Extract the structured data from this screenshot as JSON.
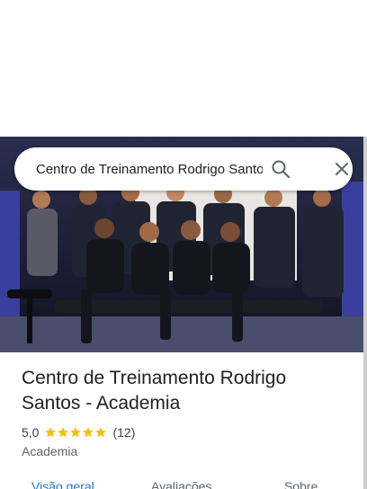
{
  "search": {
    "value": "Centro de Treinamento Rodrigo Santos - Academia",
    "search_icon": "search-icon",
    "close_icon": "close-icon"
  },
  "hero": {
    "description_icon": "place-photo",
    "background_color": "#1b1d33"
  },
  "place": {
    "title": "Centro de Treinamento Rodrigo Santos - Academia",
    "rating": "5,0",
    "star_count": 5,
    "star_color": "#fbbc04",
    "reviews": "(12)",
    "category": "Academia"
  },
  "tabs": [
    {
      "label": "Visão geral",
      "active": true
    },
    {
      "label": "Avaliações",
      "active": false
    },
    {
      "label": "Sobre",
      "active": false
    }
  ],
  "colors": {
    "accent": "#1a73e8",
    "text": "#202124",
    "muted": "#5f6368"
  }
}
